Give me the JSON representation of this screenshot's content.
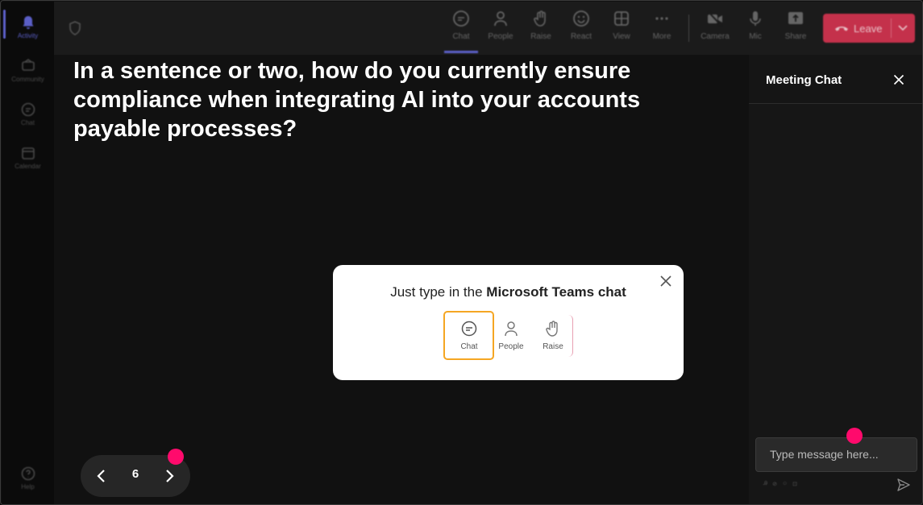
{
  "rail": {
    "items": [
      {
        "label": "Activity",
        "icon": "bell-icon"
      },
      {
        "label": "Community",
        "icon": "community-icon"
      },
      {
        "label": "Chat",
        "icon": "chat-icon"
      },
      {
        "label": "Calendar",
        "icon": "calendar-icon"
      },
      {
        "label": "Help",
        "icon": "help-icon"
      }
    ]
  },
  "toolbar": {
    "buttons": [
      {
        "label": "Chat",
        "icon": "chat-icon"
      },
      {
        "label": "People",
        "icon": "people-icon"
      },
      {
        "label": "Raise",
        "icon": "raise-hand-icon"
      },
      {
        "label": "React",
        "icon": "react-icon"
      },
      {
        "label": "View",
        "icon": "view-grid-icon"
      },
      {
        "label": "More",
        "icon": "more-icon"
      },
      {
        "label": "Camera",
        "icon": "camera-icon"
      },
      {
        "label": "Mic",
        "icon": "mic-icon"
      },
      {
        "label": "Share",
        "icon": "share-icon"
      }
    ],
    "leave_label": "Leave",
    "leave_color": "#c4314b"
  },
  "stage": {
    "question": "In a sentence or two, how do you currently ensure compliance when integrating AI into your accounts payable processes?",
    "pager": {
      "current": "6"
    }
  },
  "popup": {
    "text_prefix": "Just type in the ",
    "text_bold": "Microsoft Teams chat",
    "items": [
      {
        "label": "Chat",
        "icon": "chat-icon"
      },
      {
        "label": "People",
        "icon": "people-icon"
      },
      {
        "label": "Raise",
        "icon": "raise-hand-icon"
      }
    ],
    "highlight_color": "#f5a623"
  },
  "chat": {
    "title": "Meeting Chat",
    "input_placeholder": "Type message here..."
  },
  "colors": {
    "accent": "#5b5fc7",
    "marker": "#ff0a6c"
  }
}
